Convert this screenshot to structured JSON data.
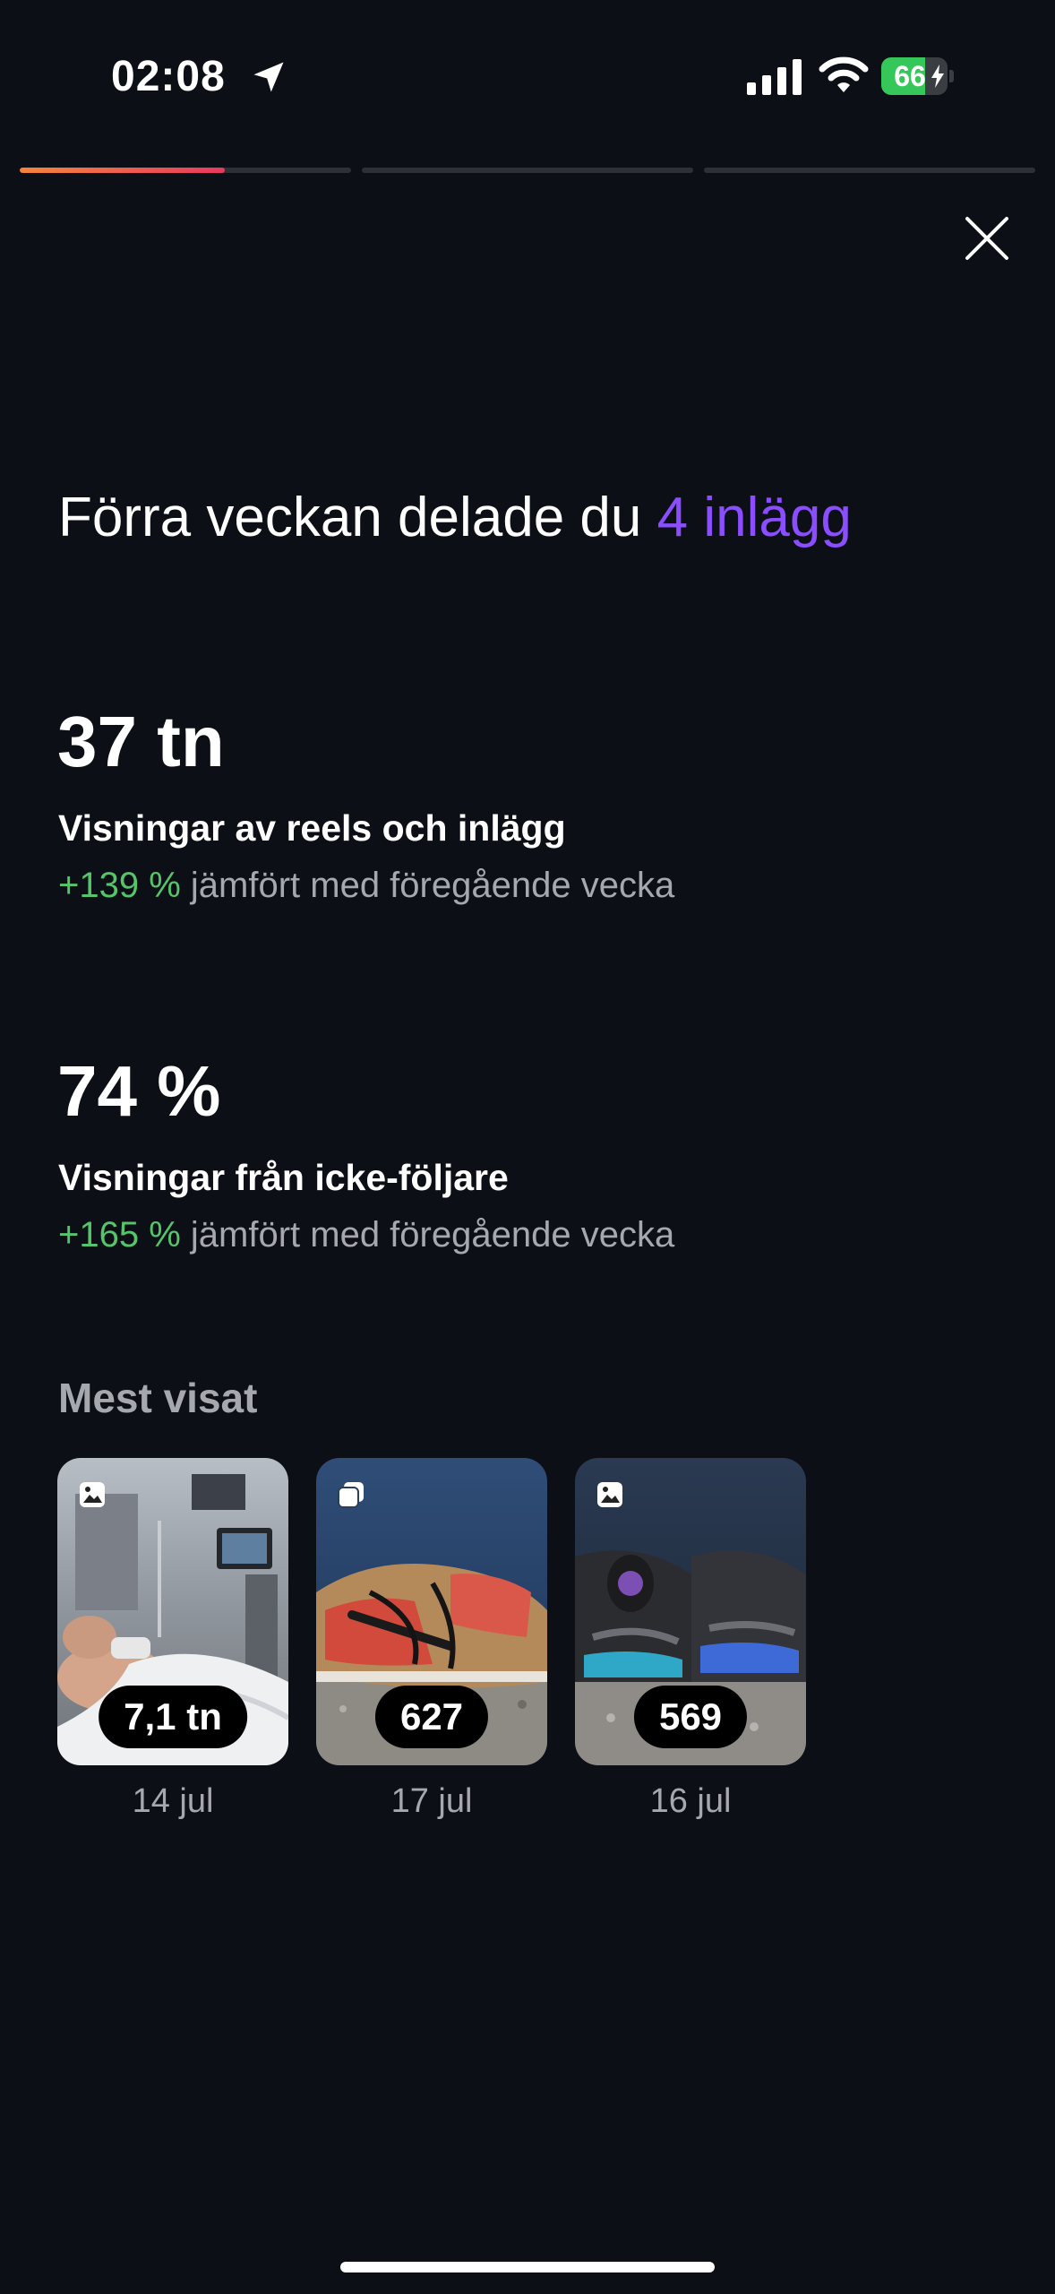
{
  "status_bar": {
    "time": "02:08",
    "battery_level": "66",
    "battery_fraction": 0.66,
    "icons": [
      "location-arrow-icon",
      "cellular-signal-icon",
      "wifi-icon",
      "battery-charging-icon"
    ]
  },
  "story_progress": {
    "segments": [
      {
        "fill_fraction": 0.62
      },
      {
        "fill_fraction": 0
      },
      {
        "fill_fraction": 0
      }
    ],
    "gradient_colors": [
      "#f5843c",
      "#e8395f"
    ]
  },
  "close_icon": "close-x-icon",
  "headline": {
    "text": "Förra veckan delade du ",
    "highlight": "4 inlägg",
    "highlight_color": "#8a4dff"
  },
  "stats": [
    {
      "value": "37 tn",
      "label": "Visningar av reels och inlägg",
      "change": "+139 %",
      "comparison": " jämfört med föregående vecka"
    },
    {
      "value": "74 %",
      "label": "Visningar från icke-följare",
      "change": "+165 %",
      "comparison": " jämfört med föregående vecka"
    }
  ],
  "most_viewed": {
    "title": "Mest visat",
    "posts": [
      {
        "views": "7,1 tn",
        "date": "14 jul",
        "type_icon": "photo-icon"
      },
      {
        "views": "627",
        "date": "17 jul",
        "type_icon": "carousel-icon"
      },
      {
        "views": "569",
        "date": "16 jul",
        "type_icon": "photo-icon"
      }
    ]
  },
  "colors": {
    "background": "#0c0f15",
    "positive": "#55c46a",
    "muted_text": "#a6a8ae",
    "accent": "#8a4dff"
  }
}
